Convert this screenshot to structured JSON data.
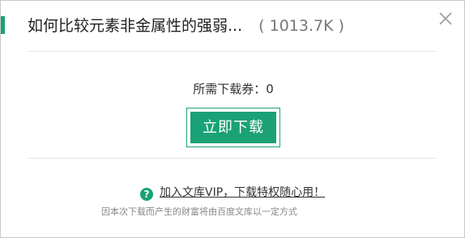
{
  "dialog": {
    "title": "如何比较元素非金属性的强弱...",
    "file_size": "( 1013.7K )",
    "close_icon": "close-icon",
    "coupon_text": "所需下载券：0",
    "download_button": "立即下载",
    "help_icon": "question-circle-icon",
    "help_icon_glyph": "?",
    "vip_link": "加入文库VIP，下载特权随心用！",
    "notice": "因本次下载而产生的财富将由百度文库以一定方式",
    "colors": {
      "accent": "#1ba176",
      "text": "#222222",
      "muted": "#888888"
    }
  }
}
